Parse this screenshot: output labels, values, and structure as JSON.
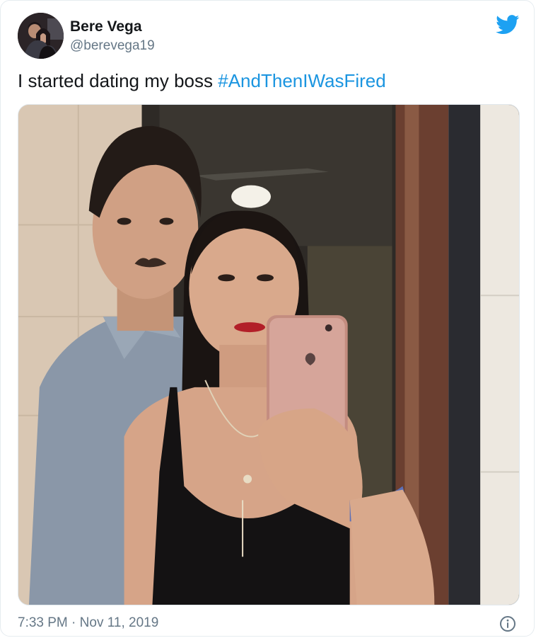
{
  "author": {
    "name": "Bere Vega",
    "handle": "@berevega19"
  },
  "tweet": {
    "text_prefix": "I started dating my boss ",
    "hashtag": "#AndThenIWasFired"
  },
  "footer": {
    "time": "7:33 PM",
    "separator": " · ",
    "date": "Nov 11, 2019"
  },
  "icons": {
    "brand": "twitter-bird-icon",
    "info": "info-icon"
  },
  "colors": {
    "accent": "#1da1f2",
    "hashtag": "#1b95e0",
    "muted": "#657786"
  }
}
